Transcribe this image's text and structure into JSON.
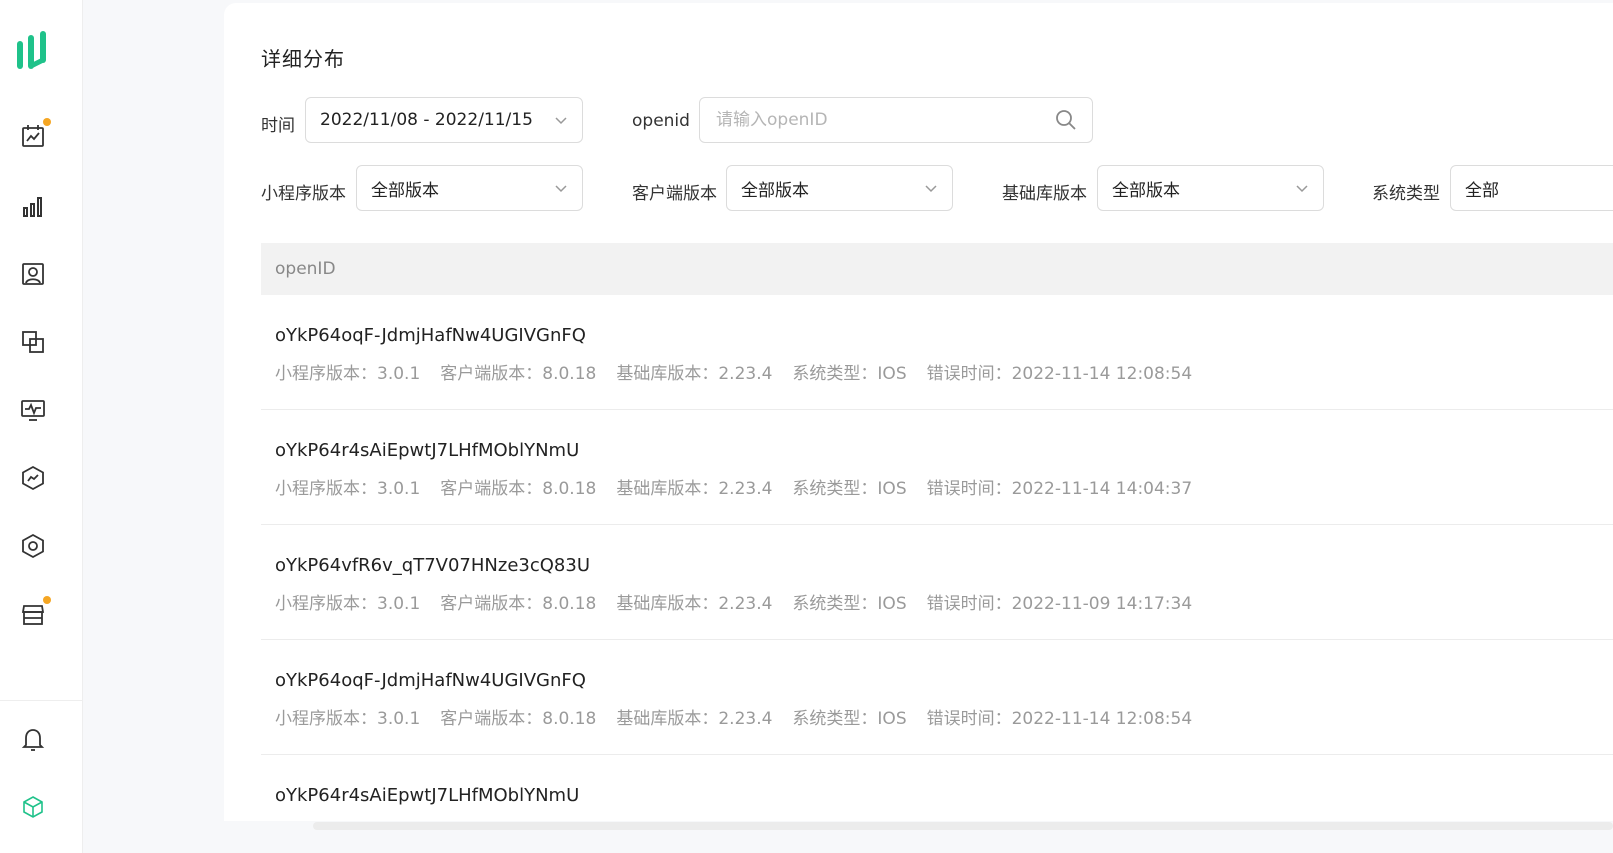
{
  "page": {
    "title": "详细分布"
  },
  "sidebar": {
    "icons": [
      {
        "name": "calendar-chart-icon",
        "badge": true
      },
      {
        "name": "bar-chart-icon",
        "badge": false
      },
      {
        "name": "user-card-icon",
        "badge": false
      },
      {
        "name": "copy-squares-icon",
        "badge": false
      },
      {
        "name": "monitor-pulse-icon",
        "badge": false
      },
      {
        "name": "hexagon-trend-icon",
        "badge": false
      },
      {
        "name": "hexagon-settings-icon",
        "badge": false
      },
      {
        "name": "store-icon",
        "badge": true
      },
      {
        "name": "bell-icon",
        "badge": false
      },
      {
        "name": "cube-icon",
        "badge": false
      }
    ],
    "badge_color": "#f5a623",
    "logo_color": "#1fc28a"
  },
  "filters": {
    "time_label": "时间",
    "time_value": "2022/11/08 - 2022/11/15",
    "openid_label": "openid",
    "openid_placeholder": "请输入openID",
    "mini_version_label": "小程序版本",
    "mini_version_value": "全部版本",
    "client_version_label": "客户端版本",
    "client_version_value": "全部版本",
    "base_version_label": "基础库版本",
    "base_version_value": "全部版本",
    "os_label": "系统类型",
    "os_value": "全部"
  },
  "table": {
    "header": "openID",
    "rows": [
      {
        "openid": "oYkP64oqF-JdmjHafNw4UGIVGnFQ",
        "mini": "小程序版本：3.0.1",
        "client": "客户端版本：8.0.18",
        "base": "基础库版本：2.23.4",
        "os": "系统类型：IOS",
        "time": "错误时间：2022-11-14 12:08:54"
      },
      {
        "openid": "oYkP64r4sAiEpwtJ7LHfMOblYNmU",
        "mini": "小程序版本：3.0.1",
        "client": "客户端版本：8.0.18",
        "base": "基础库版本：2.23.4",
        "os": "系统类型：IOS",
        "time": "错误时间：2022-11-14 14:04:37"
      },
      {
        "openid": "oYkP64vfR6v_qT7V07HNze3cQ83U",
        "mini": "小程序版本：3.0.1",
        "client": "客户端版本：8.0.18",
        "base": "基础库版本：2.23.4",
        "os": "系统类型：IOS",
        "time": "错误时间：2022-11-09 14:17:34"
      },
      {
        "openid": "oYkP64oqF-JdmjHafNw4UGIVGnFQ",
        "mini": "小程序版本：3.0.1",
        "client": "客户端版本：8.0.18",
        "base": "基础库版本：2.23.4",
        "os": "系统类型：IOS",
        "time": "错误时间：2022-11-14 12:08:54"
      },
      {
        "openid": "oYkP64r4sAiEpwtJ7LHfMOblYNmU",
        "mini": "",
        "client": "",
        "base": "",
        "os": "",
        "time": ""
      }
    ]
  }
}
